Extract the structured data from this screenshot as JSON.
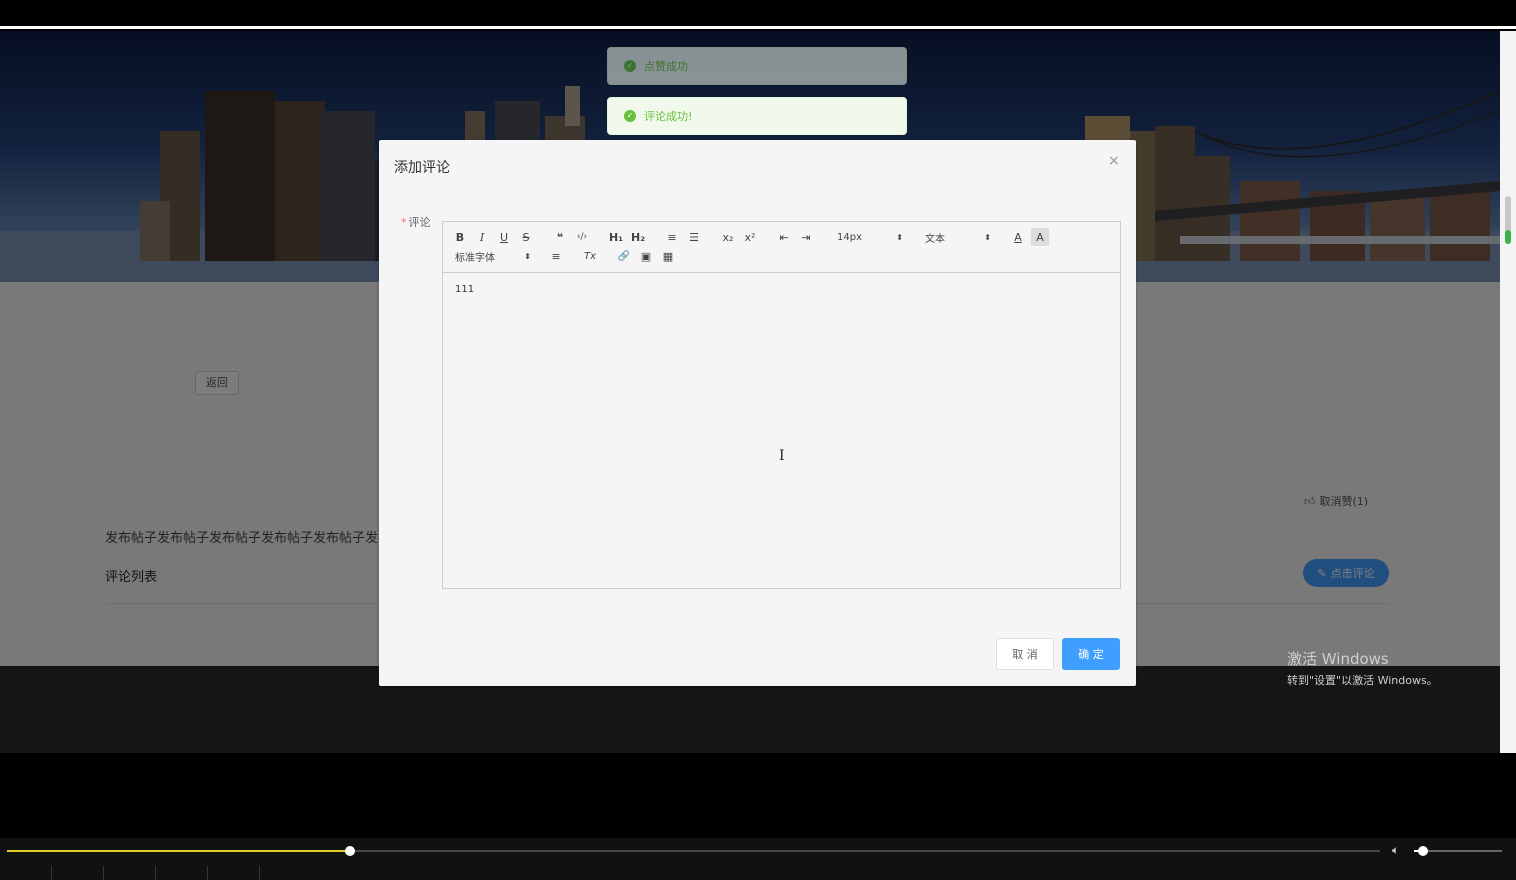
{
  "toasts": [
    {
      "text": "点赞成功"
    },
    {
      "text": "评论成功!"
    }
  ],
  "page": {
    "back_label": "返回",
    "like_label": "取消赞(1)",
    "post_text": "发布帖子发布帖子发布帖子发布帖子发布帖子发布",
    "comment_list_label": "评论列表",
    "comment_button_label": "点击评论"
  },
  "dialog": {
    "title": "添加评论",
    "close_glyph": "×",
    "field_label": "评论",
    "required_mark": "*",
    "toolbar": {
      "bold": "B",
      "italic": "I",
      "underline": "U",
      "strike": "S",
      "quote": "❝",
      "code": "‹/›",
      "h1": "H₁",
      "h2": "H₂",
      "ordered_list": "≡",
      "bullet_list": "☰",
      "subscript": "x₂",
      "superscript": "x²",
      "indent_less": "⇤",
      "indent_more": "⇥",
      "size_value": "14px",
      "header_value": "文本",
      "font_value": "标准字体",
      "color": "A",
      "background": "A",
      "align": "≡",
      "clean": "Tx",
      "link": "🔗",
      "image": "▣",
      "video": "▦"
    },
    "content": "111",
    "cancel_label": "取 消",
    "confirm_label": "确 定"
  },
  "watermark": {
    "line1": "激活 Windows",
    "line2": "转到\"设置\"以激活 Windows。"
  },
  "player": {
    "progress": 0.25,
    "volume": 0.1
  },
  "colors": {
    "primary": "#409eff",
    "success": "#67c23a",
    "seek": "#e2cc2a"
  }
}
